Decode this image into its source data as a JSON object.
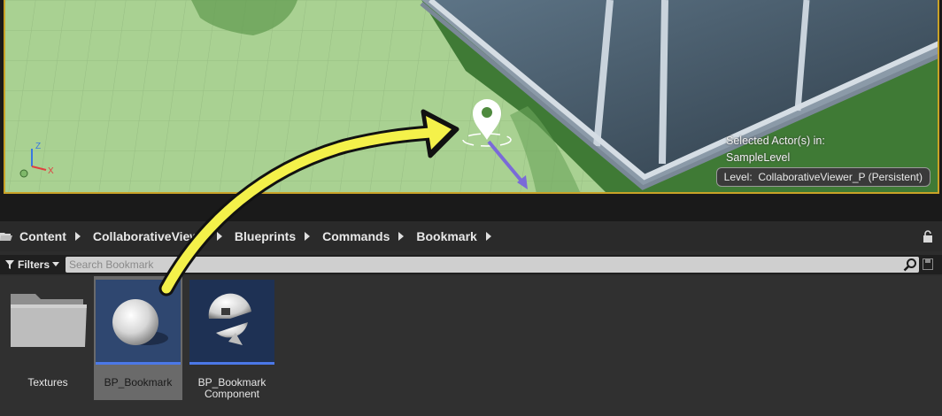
{
  "viewport": {
    "selected_actors_label": "Selected Actor(s) in:",
    "selected_actors_level": "SampleLevel",
    "level_label": "Level:",
    "level_name": "CollaborativeViewer_P (Persistent)",
    "axis_labels": {
      "z": "Z",
      "x": "X"
    },
    "accent_color": "#c9a227"
  },
  "content_browser": {
    "breadcrumbs": [
      "Content",
      "CollaborativeViewer",
      "Blueprints",
      "Commands",
      "Bookmark"
    ],
    "filters_label": "Filters",
    "search_placeholder": "Search Bookmark",
    "assets": [
      {
        "name": "Textures",
        "type": "folder"
      },
      {
        "name": "BP_Bookmark",
        "type": "blueprint",
        "selected": true
      },
      {
        "name": "BP_Bookmark\nComponent",
        "type": "blueprint-component"
      }
    ],
    "icons": [
      "folder-icon",
      "lock-icon",
      "filter-icon",
      "search-icon",
      "save-icon"
    ]
  },
  "annotation": {
    "arrow_color": "#f4f14a"
  }
}
